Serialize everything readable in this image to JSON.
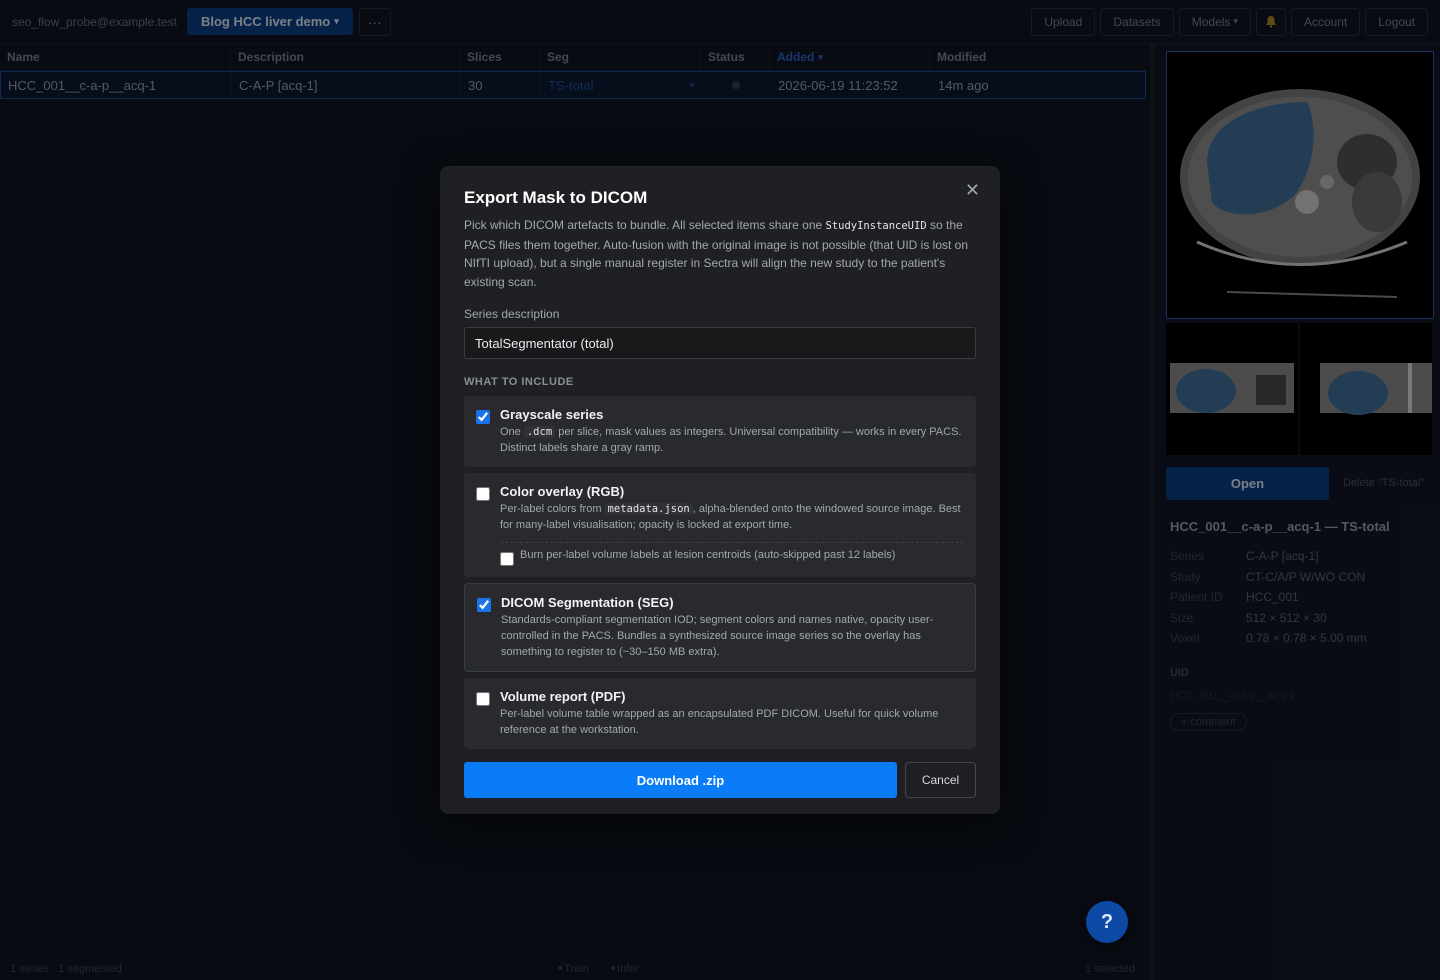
{
  "topbar": {
    "user_email": "seo_flow_probe@example.test",
    "project": "Blog HCC liver demo",
    "more": "···",
    "upload": "Upload",
    "datasets": "Datasets",
    "models": "Models",
    "account": "Account",
    "logout": "Logout"
  },
  "table": {
    "headers": [
      "Name",
      "Description",
      "Slices",
      "Seg",
      "Status",
      "Added",
      "Modified"
    ],
    "sort_indicator": "▾",
    "row": {
      "name": "HCC_001__c-a-p__acq-1",
      "description": "C-A-P [acq-1]",
      "slices": "30",
      "seg": "TS-total",
      "seg_caret": "▾",
      "added": "2026-06-19 11:23:52",
      "modified": "14m ago"
    }
  },
  "statusbar": {
    "left": "1 series · 1 segmented",
    "train": "Train",
    "infer": "Infer",
    "right": "1 selected"
  },
  "panel": {
    "open_label": "Open",
    "delete_label": "Delete \"TS-total\"",
    "title": "HCC_001__c-a-p__acq-1 — TS-total",
    "meta": [
      {
        "k": "Series",
        "v": "C-A-P [acq-1]"
      },
      {
        "k": "Study",
        "v": "CT-C/A/P W/WO CON"
      },
      {
        "k": "Patient ID",
        "v": "HCC_001"
      },
      {
        "k": "Size",
        "v": "512 × 512 × 30"
      },
      {
        "k": "Voxel",
        "v": "0.78 × 0.78 × 5.00 mm"
      }
    ],
    "uid_label": "UID",
    "uid_value": "HCC_001__c-a-p__acq-1",
    "comment": "+ comment"
  },
  "help": "?",
  "modal": {
    "title": "Export Mask to DICOM",
    "close": "✕",
    "intro_1": "Pick which DICOM artefacts to bundle. All selected items share one ",
    "intro_code": "StudyInstanceUID",
    "intro_2": " so the PACS files them together. Auto-fusion with the original image is not possible (that UID is lost on NIfTI upload), but a single manual register in Sectra will align the new study to the patient's existing scan.",
    "series_label": "Series description",
    "series_value": "TotalSegmentator (total)",
    "section": "WHAT TO INCLUDE",
    "options": {
      "grayscale": {
        "title": "Grayscale series",
        "d1": "One ",
        "code": ".dcm",
        "d2": " per slice, mask values as integers. Universal compatibility — works in every PACS. Distinct labels share a gray ramp.",
        "checked": true
      },
      "color": {
        "title": "Color overlay (RGB)",
        "d1": "Per-label colors from ",
        "code": "metadata.json",
        "d2": ", alpha-blended onto the windowed source image. Best for many-label visualisation; opacity is locked at export time.",
        "checked": false,
        "sub": "Burn per-label volume labels at lesion centroids (auto-skipped past 12 labels)"
      },
      "seg": {
        "title": "DICOM Segmentation (SEG)",
        "desc": "Standards-compliant segmentation IOD; segment colors and names native, opacity user-controlled in the PACS. Bundles a synthesized source image series so the overlay has something to register to (~30–150 MB extra).",
        "checked": true
      },
      "pdf": {
        "title": "Volume report (PDF)",
        "desc": "Per-label volume table wrapped as an encapsulated PDF DICOM. Useful for quick volume reference at the workstation.",
        "checked": false
      }
    },
    "download": "Download .zip",
    "cancel": "Cancel"
  }
}
